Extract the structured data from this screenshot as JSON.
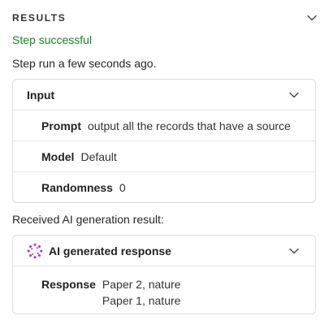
{
  "results": {
    "title": "RESULTS",
    "status": "Step successful",
    "ran_at": "Step run a few seconds ago."
  },
  "input_card": {
    "title": "Input",
    "fields": [
      {
        "label": "Prompt",
        "value": "output all the records that have a source"
      },
      {
        "label": "Model",
        "value": "Default"
      },
      {
        "label": "Randomness",
        "value": "0"
      }
    ]
  },
  "received_text": "Received AI generation result:",
  "ai_card": {
    "title": "AI generated response",
    "response_label": "Response",
    "response_lines": [
      "Paper 2, nature",
      "Paper 1, nature"
    ]
  },
  "colors": {
    "success": "#1a7f26",
    "sparkle": "#c026d3"
  },
  "icons": {
    "collapse": "chevron-down-icon",
    "ai": "sparkle-icon"
  }
}
